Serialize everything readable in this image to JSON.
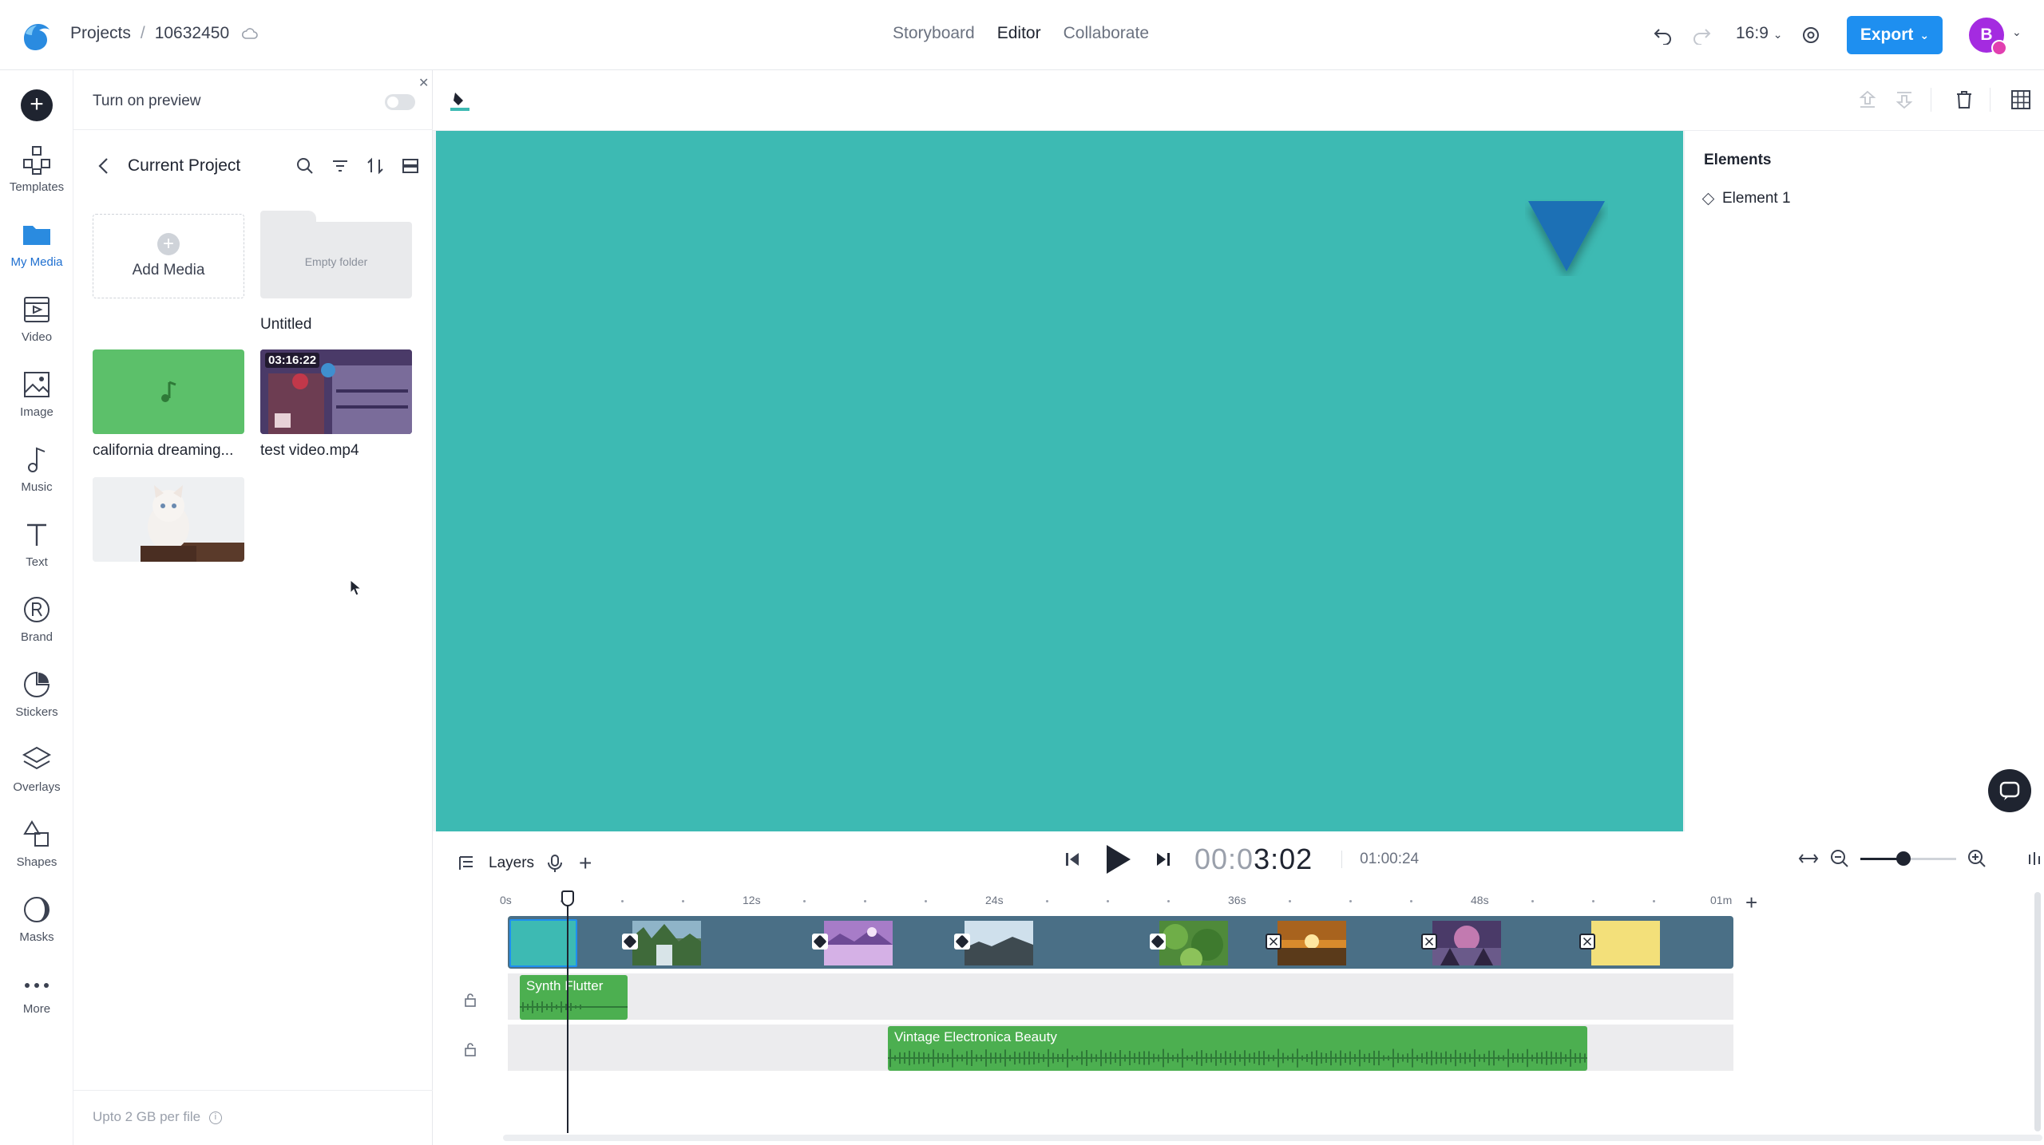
{
  "topbar": {
    "breadcrumb_root": "Projects",
    "breadcrumb_sep": "/",
    "project_id": "10632450",
    "modes": [
      "Storyboard",
      "Editor",
      "Collaborate"
    ],
    "active_mode": "Editor",
    "aspect_ratio": "16:9",
    "export_label": "Export",
    "avatar_initial": "B",
    "accent_color": "#1e8ff0"
  },
  "rail": {
    "items": [
      {
        "label": "Templates",
        "icon": "templates-icon"
      },
      {
        "label": "My Media",
        "icon": "folder-icon"
      },
      {
        "label": "Video",
        "icon": "video-icon"
      },
      {
        "label": "Image",
        "icon": "image-icon"
      },
      {
        "label": "Music",
        "icon": "music-icon"
      },
      {
        "label": "Text",
        "icon": "text-icon"
      },
      {
        "label": "Brand",
        "icon": "brand-icon"
      },
      {
        "label": "Stickers",
        "icon": "sticker-icon"
      },
      {
        "label": "Overlays",
        "icon": "layers-icon"
      },
      {
        "label": "Shapes",
        "icon": "shapes-icon"
      },
      {
        "label": "Masks",
        "icon": "mask-icon"
      },
      {
        "label": "More",
        "icon": "more-icon"
      }
    ],
    "active": "My Media"
  },
  "panel": {
    "preview_label": "Turn on preview",
    "preview_enabled": false,
    "title": "Current Project",
    "add_media_label": "Add Media",
    "folder_label": "Empty folder",
    "folder_name": "Untitled",
    "media": [
      {
        "name": "california dreaming...",
        "type": "audio"
      },
      {
        "name": "test video.mp4",
        "type": "video",
        "duration": "03:16:22"
      },
      {
        "name": "",
        "type": "image"
      }
    ],
    "footer": "Upto 2 GB per file"
  },
  "canvas": {
    "background_color": "#3dbab3",
    "shape_color": "#1e6fb5"
  },
  "elements_panel": {
    "title": "Elements",
    "items": [
      "Element 1"
    ]
  },
  "timeline": {
    "layers_label": "Layers",
    "timecode_dim": "00:0",
    "timecode_strong": "3:02",
    "duration": "01:00:24",
    "zoom_level": 0.45,
    "ruler_labels": [
      "0s",
      "12s",
      "24s",
      "36s",
      "48s",
      "01m"
    ],
    "audio_clips": [
      {
        "name": "Synth Flutter"
      },
      {
        "name": "Vintage Electronica Beauty"
      }
    ]
  }
}
